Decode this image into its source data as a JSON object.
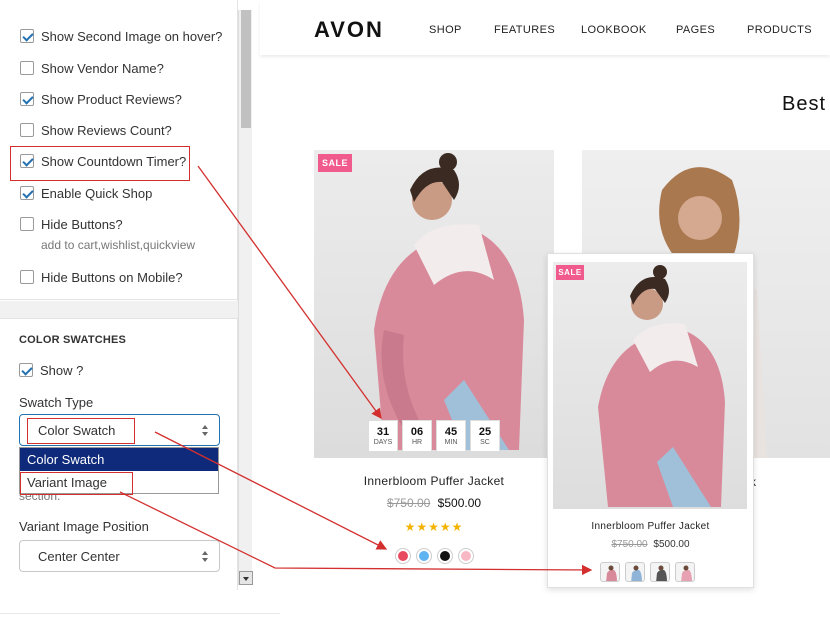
{
  "settings": {
    "checkboxes": [
      {
        "label": "Show Second Image on hover?",
        "checked": true
      },
      {
        "label": "Show Vendor Name?",
        "checked": false
      },
      {
        "label": "Show Product Reviews?",
        "checked": true
      },
      {
        "label": "Show Reviews Count?",
        "checked": false
      },
      {
        "label": "Show Countdown Timer?",
        "checked": true
      },
      {
        "label": "Enable Quick Shop",
        "checked": true
      },
      {
        "label": "Hide Buttons?",
        "checked": false
      },
      {
        "label": "Hide Buttons on Mobile?",
        "checked": false
      }
    ],
    "hide_buttons_hint": "add to cart,wishlist,quickview",
    "color_swatches": {
      "title": "COLOR SWATCHES",
      "show_label": "Show ?",
      "show_checked": true,
      "swatch_type_label": "Swatch Type",
      "swatch_type_value": "Color Swatch",
      "dropdown_options": [
        "Color Swatch",
        "Variant Image"
      ],
      "section_tail": "section.",
      "variant_position_label": "Variant Image Position",
      "variant_position_value": "Center Center"
    }
  },
  "store": {
    "logo": "AVON",
    "nav": [
      "SHOP",
      "FEATURES",
      "LOOKBOOK",
      "PAGES",
      "PRODUCTS"
    ],
    "heading": "Best",
    "sale_badge": "SALE",
    "countdown": [
      {
        "value": "31",
        "unit": "DAYS"
      },
      {
        "value": "06",
        "unit": "HR"
      },
      {
        "value": "45",
        "unit": "MIN"
      },
      {
        "value": "25",
        "unit": "SC"
      }
    ],
    "product_title": "Innerbloom Puffer Jacket",
    "old_price": "$750.00",
    "new_price": "$500.00",
    "stars": "★★★★★",
    "rating": 5,
    "swatch_colors": [
      "#e84a5f",
      "#5fb3f0",
      "#111111",
      "#f7b8c4"
    ],
    "cut_title": "k",
    "overlay_card": {
      "sale_badge": "SALE",
      "title": "Innerbloom Puffer Jacket",
      "old_price": "$750.00",
      "new_price": "$500.00",
      "thumb_count": 4
    }
  },
  "colors": {
    "accent_blue": "#2271b1",
    "dropdown_active": "#0f2a7a",
    "sale_pink": "#f05a8c",
    "annotation_red": "#d32f2f",
    "jacket_pink": "#d88a9a"
  }
}
